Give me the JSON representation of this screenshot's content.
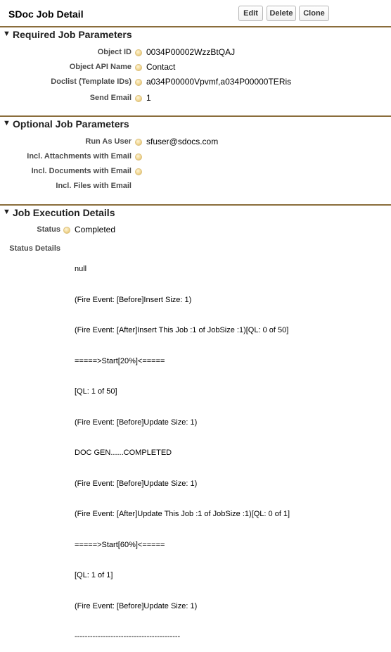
{
  "header": {
    "title": "SDoc Job Detail",
    "buttons": {
      "edit": "Edit",
      "delete": "Delete",
      "clone": "Clone"
    }
  },
  "sections": {
    "required": {
      "title": "Required Job Parameters",
      "fields": [
        {
          "label": "Object ID",
          "value": "0034P00002WzzBtQAJ"
        },
        {
          "label": "Object API Name",
          "value": "Contact"
        },
        {
          "label": "Doclist (Template IDs)",
          "value": "a034P00000Vpvmf,a034P00000TERis"
        },
        {
          "label": "Send Email",
          "value": "1"
        }
      ]
    },
    "optional": {
      "title": "Optional Job Parameters",
      "fields": [
        {
          "label": "Run As User",
          "value": "sfuser@sdocs.com"
        },
        {
          "label": "Incl. Attachments with Email",
          "value": ""
        },
        {
          "label": "Incl. Documents with Email",
          "value": ""
        },
        {
          "label": "Incl. Files with Email",
          "value": ""
        }
      ]
    },
    "execution": {
      "title": "Job Execution Details",
      "status_label": "Status",
      "status_value": "Completed",
      "details_label": "Status Details",
      "details_lines": [
        "null",
        "(Fire Event: [Before]Insert Size: 1)",
        "(Fire Event: [After]Insert This Job :1 of JobSize :1)[QL: 0 of 50]",
        "=====>Start[20%]<=====",
        "[QL: 1 of 50]",
        "(Fire Event: [Before]Update Size: 1)",
        "DOC GEN......COMPLETED",
        "(Fire Event: [Before]Update Size: 1)",
        "(Fire Event: [After]Update This Job :1 of JobSize :1)[QL: 0 of 1]",
        "=====>Start[60%]<=====",
        "[QL: 1 of 1]",
        "(Fire Event: [Before]Update Size: 1)",
        "-----------------------------------------"
      ]
    }
  }
}
